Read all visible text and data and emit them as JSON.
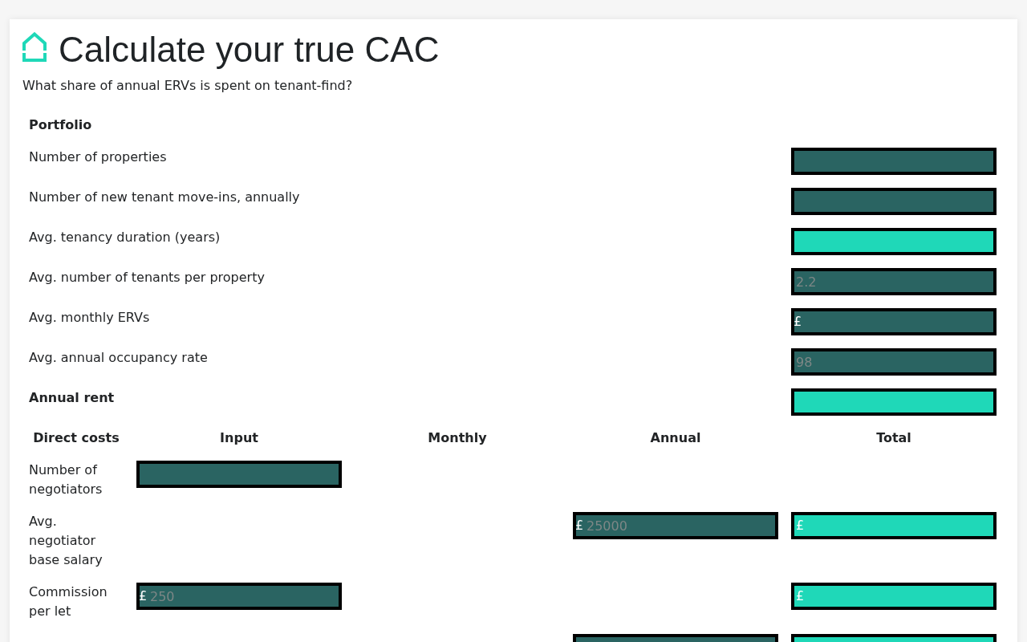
{
  "header": {
    "title": "Calculate your true CAC",
    "subtitle": "What share of annual ERVs is spent on tenant-find?"
  },
  "portfolio": {
    "heading": "Portfolio",
    "rows": [
      {
        "label": "Number of properties",
        "field": {
          "kind": "input"
        }
      },
      {
        "label": "Number of new tenant move-ins, annually",
        "field": {
          "kind": "input"
        }
      },
      {
        "label": "Avg. tenancy duration (years)",
        "field": {
          "kind": "output"
        }
      },
      {
        "label": "Avg. number of tenants per property",
        "field": {
          "kind": "input",
          "placeholder": "2.2"
        }
      },
      {
        "label": "Avg. monthly ERVs",
        "field": {
          "kind": "input",
          "prefix": "£"
        }
      },
      {
        "label": "Avg. annual occupancy rate",
        "field": {
          "kind": "input",
          "placeholder": "98"
        }
      }
    ]
  },
  "annual_rent": {
    "label": "Annual rent",
    "field": {
      "kind": "output"
    }
  },
  "direct_costs": {
    "columns": [
      "Direct costs",
      "Input",
      "Monthly",
      "Annual",
      "Total"
    ],
    "rows": [
      {
        "label": "Number of negotiators",
        "input": {
          "kind": "input"
        }
      },
      {
        "label": "Avg. negotiator base salary",
        "annual": {
          "kind": "input",
          "prefix": "£",
          "placeholder": "25000"
        },
        "total": {
          "kind": "output",
          "prefix": "£"
        }
      },
      {
        "label": "Commission per let",
        "input": {
          "kind": "input",
          "prefix": "£",
          "placeholder": "250"
        },
        "total": {
          "kind": "output",
          "prefix": "£"
        }
      },
      {
        "annual": {
          "kind": "input"
        },
        "total": {
          "kind": "output"
        }
      }
    ]
  }
}
